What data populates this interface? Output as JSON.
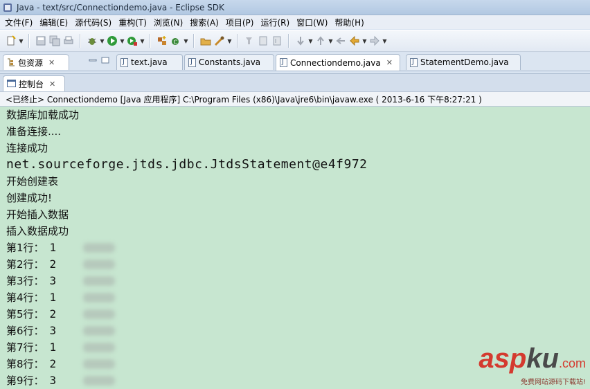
{
  "window": {
    "title": "Java  -  text/src/Connectiondemo.java  -  Eclipse SDK"
  },
  "menu": [
    "文件(F)",
    "编辑(E)",
    "源代码(S)",
    "重构(T)",
    "浏览(N)",
    "搜索(A)",
    "项目(P)",
    "运行(R)",
    "窗口(W)",
    "帮助(H)"
  ],
  "package_view": {
    "tab_label": "包资源",
    "close": "✕"
  },
  "editor_tabs": [
    {
      "label": "text.java",
      "active": false
    },
    {
      "label": "Constants.java",
      "active": false
    },
    {
      "label": "Connectiondemo.java",
      "active": true,
      "close": "✕"
    },
    {
      "label": "StatementDemo.java",
      "active": false
    }
  ],
  "console": {
    "tab_label": "控制台",
    "close": "✕",
    "status": "<已终止> Connectiondemo [Java 应用程序] C:\\Program Files (x86)\\Java\\jre6\\bin\\javaw.exe ( 2013-6-16 下午8:27:21 )",
    "lines": [
      "数据库加载成功",
      "准备连接....",
      "连接成功",
      "net.sourceforge.jtds.jdbc.JtdsStatement@e4f972",
      "开始创建表",
      "创建成功!",
      "开始插入数据",
      "插入数据成功"
    ],
    "rows": [
      {
        "label": "第1行：",
        "value": "1"
      },
      {
        "label": "第2行：",
        "value": "2"
      },
      {
        "label": "第3行：",
        "value": "3"
      },
      {
        "label": "第4行：",
        "value": "1"
      },
      {
        "label": "第5行：",
        "value": "2"
      },
      {
        "label": "第6行：",
        "value": "3"
      },
      {
        "label": "第7行：",
        "value": "1"
      },
      {
        "label": "第8行：",
        "value": "2"
      },
      {
        "label": "第9行：",
        "value": "3"
      }
    ]
  },
  "watermark": {
    "brand_a": "asp",
    "brand_b": "ku",
    "brand_c": ".com",
    "tagline": "免费网站源码下载站!"
  },
  "colors": {
    "console_bg": "#c7e6d0",
    "watermark_red": "#d43a2f"
  },
  "icons": [
    "java-app-icon",
    "new-icon",
    "save-icon",
    "save-all-icon",
    "print-icon",
    "debug-icon",
    "run-icon",
    "external-tools-icon",
    "new-java-project-icon",
    "new-class-icon",
    "open-type-icon",
    "search-icon",
    "annotation-icon",
    "next-annotation-icon",
    "prev-annotation-icon",
    "back-icon",
    "forward-icon",
    "package-explorer-icon",
    "console-icon",
    "java-file-icon",
    "minimize-icon",
    "maximize-icon",
    "close-icon"
  ]
}
